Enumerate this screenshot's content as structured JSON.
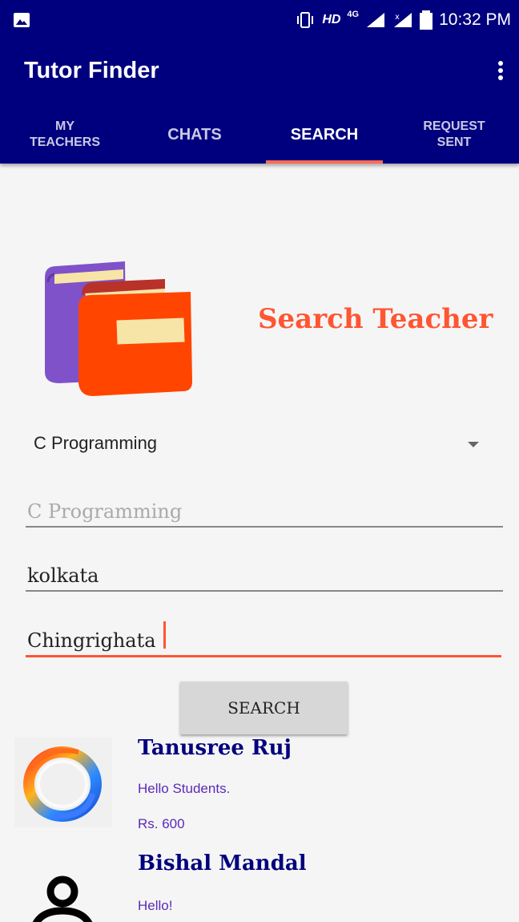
{
  "status_bar": {
    "time": "10:32 PM",
    "network": "HD",
    "network_type": "4G",
    "icons": [
      "gallery-icon",
      "vibrate-icon",
      "signal-icon",
      "no-signal-icon",
      "battery-icon"
    ]
  },
  "toolbar": {
    "title": "Tutor Finder",
    "menu_icon": "overflow-menu-icon"
  },
  "tabs": [
    {
      "label": "MY\nTEACHERS",
      "active": false
    },
    {
      "label": "CHATS",
      "active": true
    },
    {
      "label": "SEARCH",
      "active": true
    },
    {
      "label": "REQUEST\nSENT",
      "active": false
    }
  ],
  "search": {
    "heading": "Search Teacher",
    "subject_spinner_value": "C Programming",
    "subject_field_placeholder": "C Programming",
    "city_value": "kolkata",
    "area_value": "Chingrighata",
    "button_label": "SEARCH"
  },
  "results": [
    {
      "name": "Tanusree Ruj",
      "message": "Hello Students.",
      "fee": "Rs. 600",
      "avatar": "swirl-image"
    },
    {
      "name": "Bishal Mandal",
      "message": "Hello!",
      "avatar": "person-icon"
    }
  ],
  "colors": {
    "primary": "#00007e",
    "accent": "#ff5533",
    "tab_indicator": "#ff6b57",
    "result_text": "#5a2ab8"
  }
}
